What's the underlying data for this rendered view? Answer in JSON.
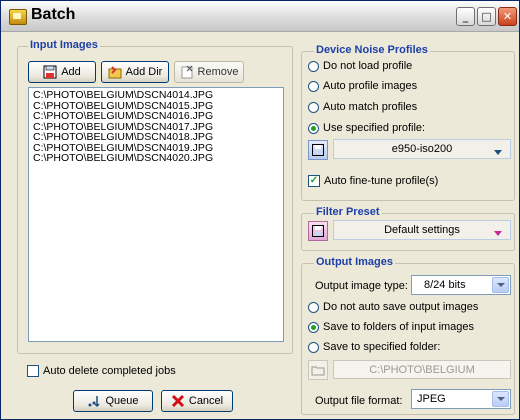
{
  "window": {
    "title": "Batch"
  },
  "input_images": {
    "legend": "Input Images",
    "add_label": "Add",
    "add_dir_label": "Add Dir",
    "remove_label": "Remove",
    "files": [
      "C:\\PHOTO\\BELGIUM\\DSCN4014.JPG",
      "C:\\PHOTO\\BELGIUM\\DSCN4015.JPG",
      "C:\\PHOTO\\BELGIUM\\DSCN4016.JPG",
      "C:\\PHOTO\\BELGIUM\\DSCN4017.JPG",
      "C:\\PHOTO\\BELGIUM\\DSCN4018.JPG",
      "C:\\PHOTO\\BELGIUM\\DSCN4019.JPG",
      "C:\\PHOTO\\BELGIUM\\DSCN4020.JPG"
    ],
    "auto_delete_label": "Auto delete completed jobs",
    "auto_delete_checked": false
  },
  "actions": {
    "queue_label": "Queue",
    "cancel_label": "Cancel"
  },
  "device_noise": {
    "legend": "Device Noise Profiles",
    "options": [
      "Do not load profile",
      "Auto profile images",
      "Auto match profiles",
      "Use specified profile:"
    ],
    "selected_index": 3,
    "profile_value": "e950-iso200",
    "auto_fine_tune_label": "Auto fine-tune profile(s)",
    "auto_fine_tune_checked": true
  },
  "filter_preset": {
    "legend": "Filter Preset",
    "value": "Default settings"
  },
  "output_images": {
    "legend": "Output Images",
    "type_label": "Output image type:",
    "type_value": "8/24 bits",
    "options": [
      "Do not auto save output images",
      "Save to folders of input images",
      "Save to specified folder:"
    ],
    "selected_index": 1,
    "folder_value": "C:\\PHOTO\\BELGIUM",
    "format_label": "Output file format:",
    "format_value": "JPEG"
  },
  "colors": {
    "legend": "#1c3fa8",
    "accent_blue": "#1c5180",
    "pink": "#c8289c",
    "title_bar_gray": "#dcdcdc",
    "face": "#ece9d8"
  },
  "icons": [
    "app-icon",
    "add-icon",
    "add-dir-icon",
    "remove-icon",
    "floppy-icon",
    "folder-icon",
    "queue-icon",
    "cancel-icon"
  ]
}
